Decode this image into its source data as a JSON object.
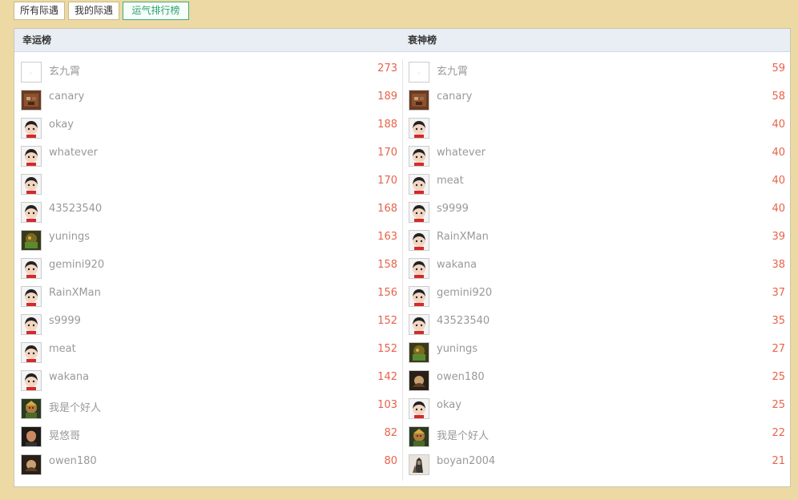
{
  "tabs": [
    {
      "label": "所有际遇"
    },
    {
      "label": "我的际遇"
    },
    {
      "label": "运气排行榜"
    }
  ],
  "colors": {
    "accent": "#2aa06e",
    "score": "#e8624a",
    "background": "#ecd9a3"
  },
  "lucky": {
    "title": "幸运榜",
    "items": [
      {
        "name": "玄九霄",
        "score": "273",
        "avatar": "blank"
      },
      {
        "name": "canary",
        "score": "189",
        "avatar": "brick"
      },
      {
        "name": "okay",
        "score": "188",
        "avatar": "default"
      },
      {
        "name": "whatever",
        "score": "170",
        "avatar": "default"
      },
      {
        "name": "",
        "score": "170",
        "avatar": "default"
      },
      {
        "name": "43523540",
        "score": "168",
        "avatar": "default"
      },
      {
        "name": "yunings",
        "score": "163",
        "avatar": "game"
      },
      {
        "name": "gemini920",
        "score": "158",
        "avatar": "default"
      },
      {
        "name": "RainXMan",
        "score": "156",
        "avatar": "default"
      },
      {
        "name": "s9999",
        "score": "152",
        "avatar": "default"
      },
      {
        "name": "meat",
        "score": "152",
        "avatar": "default"
      },
      {
        "name": "wakana",
        "score": "142",
        "avatar": "default"
      },
      {
        "name": "我是个好人",
        "score": "103",
        "avatar": "warrior"
      },
      {
        "name": "晃悠哥",
        "score": "82",
        "avatar": "photo"
      },
      {
        "name": "owen180",
        "score": "80",
        "avatar": "dark"
      }
    ]
  },
  "unlucky": {
    "title": "衰神榜",
    "items": [
      {
        "name": "玄九霄",
        "score": "59",
        "avatar": "blank"
      },
      {
        "name": "canary",
        "score": "58",
        "avatar": "brick"
      },
      {
        "name": "",
        "score": "40",
        "avatar": "default"
      },
      {
        "name": "whatever",
        "score": "40",
        "avatar": "default"
      },
      {
        "name": "meat",
        "score": "40",
        "avatar": "default"
      },
      {
        "name": "s9999",
        "score": "40",
        "avatar": "default"
      },
      {
        "name": "RainXMan",
        "score": "39",
        "avatar": "default"
      },
      {
        "name": "wakana",
        "score": "38",
        "avatar": "default"
      },
      {
        "name": "gemini920",
        "score": "37",
        "avatar": "default"
      },
      {
        "name": "43523540",
        "score": "35",
        "avatar": "default"
      },
      {
        "name": "yunings",
        "score": "27",
        "avatar": "game"
      },
      {
        "name": "owen180",
        "score": "25",
        "avatar": "dark"
      },
      {
        "name": "okay",
        "score": "25",
        "avatar": "default"
      },
      {
        "name": "我是个好人",
        "score": "22",
        "avatar": "warrior"
      },
      {
        "name": "boyan2004",
        "score": "21",
        "avatar": "knight"
      }
    ]
  }
}
